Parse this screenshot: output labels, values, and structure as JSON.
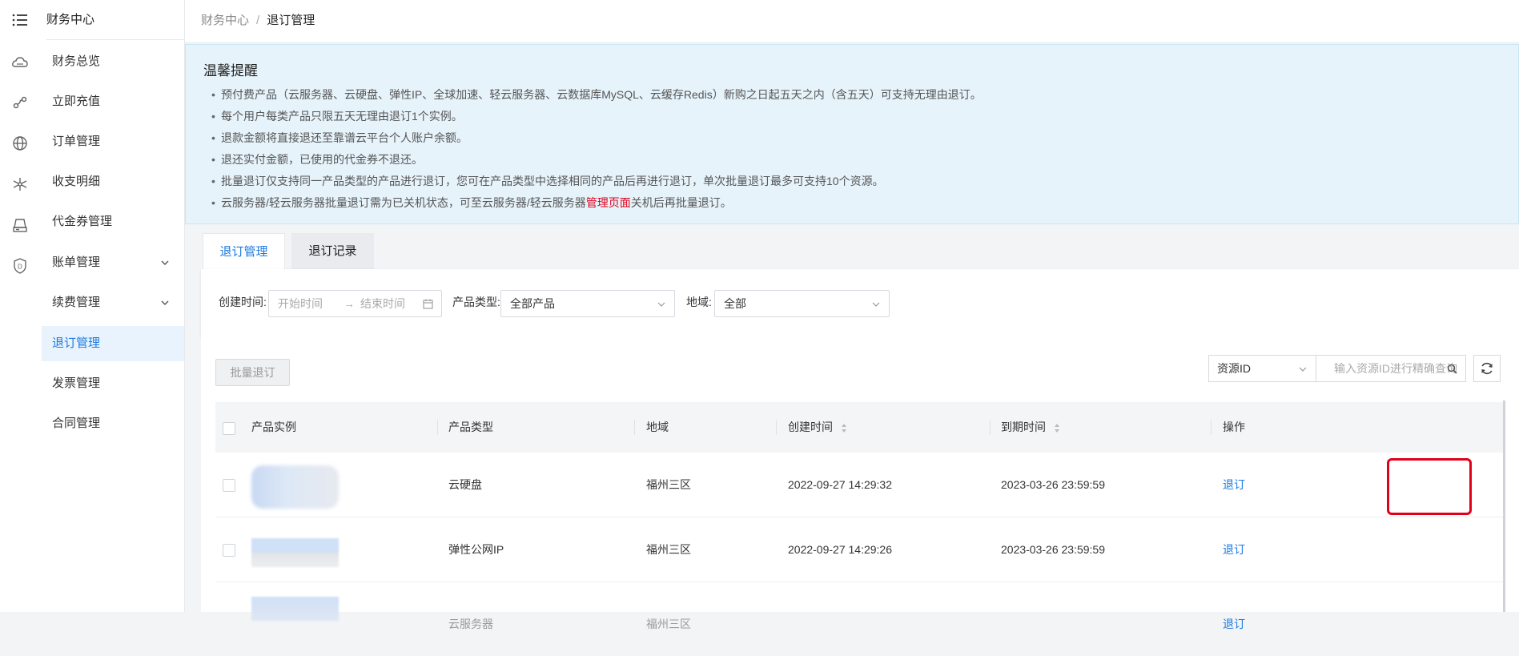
{
  "sidebar": {
    "title": "财务中心",
    "items": [
      {
        "label": "财务总览"
      },
      {
        "label": "立即充值"
      },
      {
        "label": "订单管理"
      },
      {
        "label": "收支明细"
      },
      {
        "label": "代金券管理"
      },
      {
        "label": "账单管理"
      },
      {
        "label": "续费管理"
      },
      {
        "label": "退订管理"
      },
      {
        "label": "发票管理"
      },
      {
        "label": "合同管理"
      }
    ]
  },
  "breadcrumb": {
    "parent": "财务中心",
    "separator": "/",
    "current": "退订管理"
  },
  "notice": {
    "title": "温馨提醒",
    "items": [
      "预付费产品（云服务器、云硬盘、弹性IP、全球加速、轻云服务器、云数据库MySQL、云缓存Redis）新购之日起五天之内（含五天）可支持无理由退订。",
      "每个用户每类产品只限五天无理由退订1个实例。",
      "退款金额将直接退还至靠谱云平台个人账户余额。",
      "退还实付金额，已使用的代金券不退还。",
      "批量退订仅支持同一产品类型的产品进行退订，您可在产品类型中选择相同的产品后再进行退订，单次批量退订最多可支持10个资源。"
    ],
    "last_item": {
      "before": "云服务器/轻云服务器批量退订需为已关机状态，可至云服务器/轻云服务器",
      "link": "管理页面",
      "after": "关机后再批量退订。"
    }
  },
  "tabs": [
    {
      "label": "退订管理"
    },
    {
      "label": "退订记录"
    }
  ],
  "filter": {
    "created_label": "创建时间:",
    "start_placeholder": "开始时间",
    "end_placeholder": "结束时间",
    "product_label": "产品类型:",
    "product_value": "全部产品",
    "region_label": "地域:",
    "region_value": "全部"
  },
  "toolbar": {
    "batch_label": "批量退订",
    "resource_select": "资源ID",
    "search_placeholder": "输入资源ID进行精确查询"
  },
  "table": {
    "columns": {
      "instance": "产品实例",
      "type": "产品类型",
      "region": "地域",
      "created": "创建时间",
      "expire": "到期时间",
      "action": "操作"
    },
    "rows": [
      {
        "type": "云硬盘",
        "region": "福州三区",
        "created": "2022-09-27 14:29:32",
        "expire": "2023-03-26 23:59:59",
        "action": "退订"
      },
      {
        "type": "弹性公网IP",
        "region": "福州三区",
        "created": "2022-09-27 14:29:26",
        "expire": "2023-03-26 23:59:59",
        "action": "退订"
      },
      {
        "type": "云服务器",
        "region": "福州三区",
        "created": "",
        "expire": "",
        "action": "退订"
      }
    ]
  },
  "colors": {
    "accent": "#1c7ae0",
    "highlight": "#e0001a",
    "notice_bg": "#e6f3fb"
  }
}
